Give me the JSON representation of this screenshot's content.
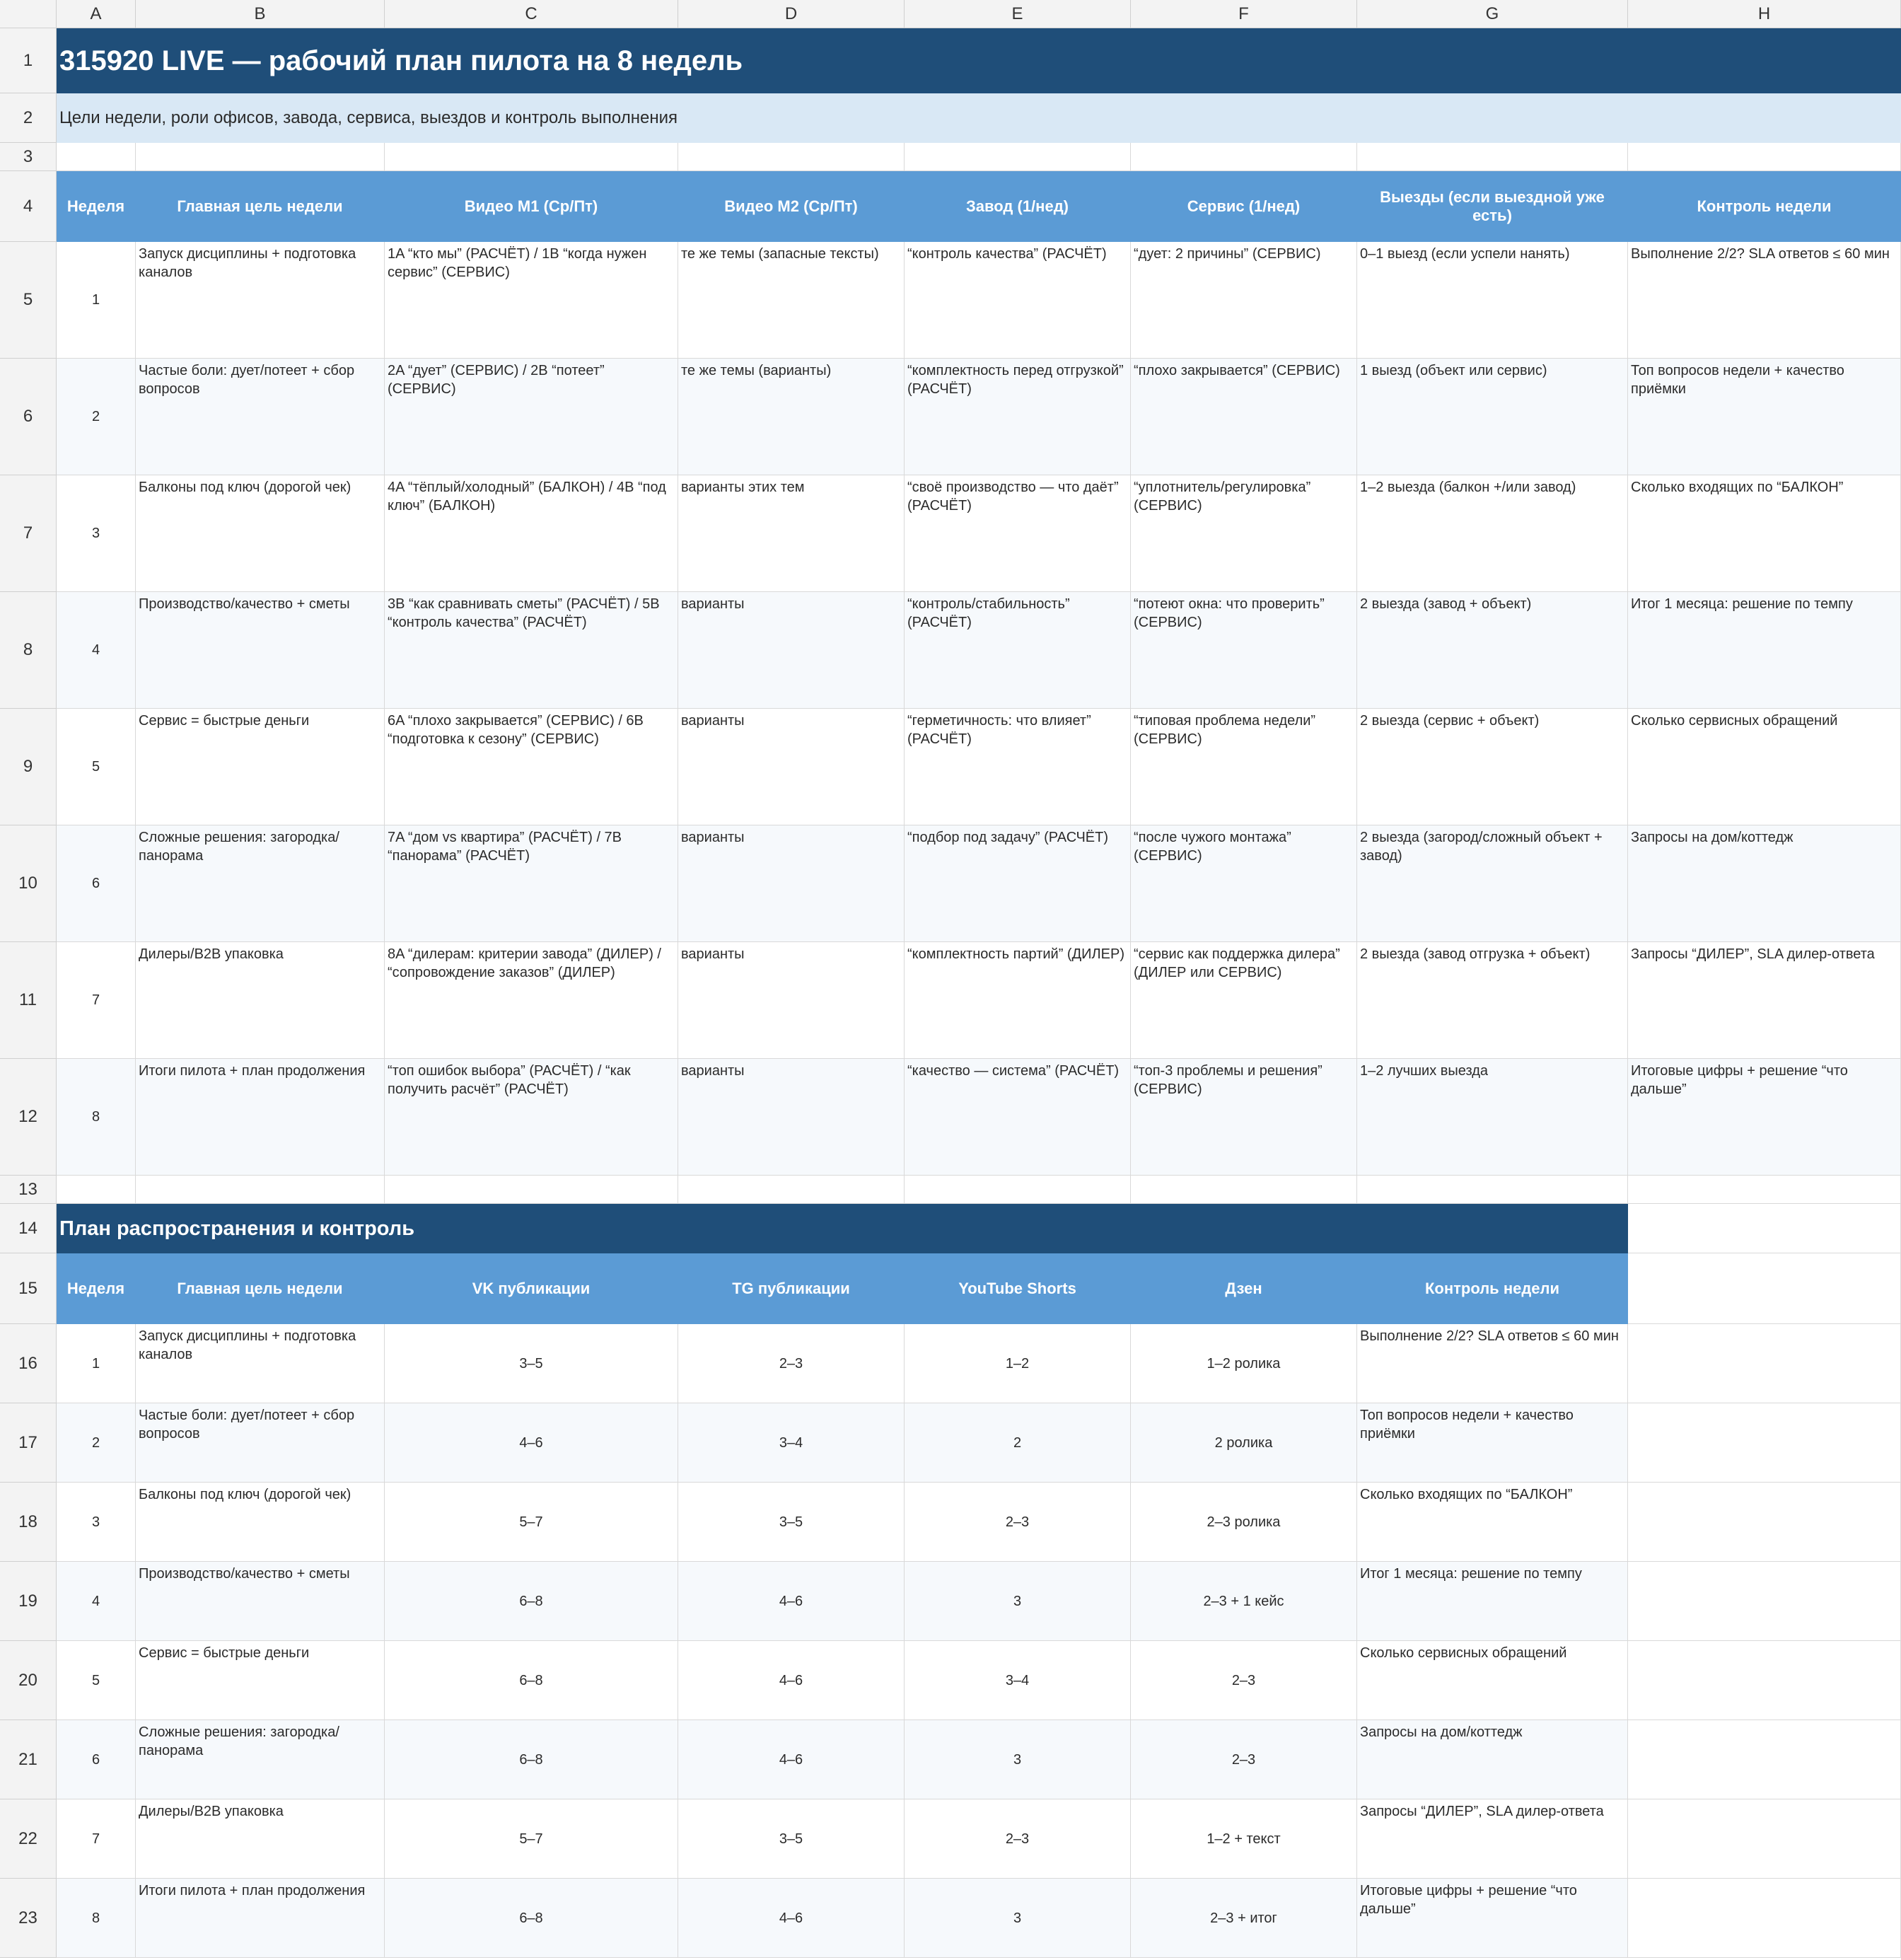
{
  "columns": [
    "A",
    "B",
    "C",
    "D",
    "E",
    "F",
    "G",
    "H"
  ],
  "rows": [
    "1",
    "2",
    "3",
    "4",
    "5",
    "6",
    "7",
    "8",
    "9",
    "10",
    "11",
    "12",
    "13",
    "14",
    "15",
    "16",
    "17",
    "18",
    "19",
    "20",
    "21",
    "22",
    "23"
  ],
  "title": "315920 LIVE — рабочий план пилота на 8 недель",
  "subtitle": "Цели недели, роли офисов, завода, сервиса, выездов и контроль выполнения",
  "plan_headers": [
    "Неделя",
    "Главная цель недели",
    "Видео М1 (Ср/Пт)",
    "Видео М2 (Ср/Пт)",
    "Завод (1/нед)",
    "Сервис (1/нед)",
    "Выезды (если выездной уже есть)",
    "Контроль недели"
  ],
  "plan_rows": [
    [
      "1",
      "Запуск дисциплины + подготовка каналов",
      "1A “кто мы” (РАСЧЁТ) / 1B “когда нужен сервис” (СЕРВИС)",
      "те же темы (запасные тексты)",
      "“контроль качества” (РАСЧЁТ)",
      "“дует: 2 причины” (СЕРВИС)",
      "0–1 выезд (если успели нанять)",
      "Выполнение 2/2? SLA ответов ≤ 60 мин"
    ],
    [
      "2",
      "Частые боли: дует/потеет + сбор вопросов",
      "2A “дует” (СЕРВИС) / 2B “потеет” (СЕРВИС)",
      "те же темы (варианты)",
      "“комплектность перед отгрузкой” (РАСЧЁТ)",
      "“плохо закрывается” (СЕРВИС)",
      "1 выезд (объект или сервис)",
      "Топ вопросов недели + качество приёмки"
    ],
    [
      "3",
      "Балконы под ключ (дорогой чек)",
      "4A “тёплый/холодный” (БАЛКОН) / 4B “под ключ” (БАЛКОН)",
      "варианты этих тем",
      "“своё производство — что даёт” (РАСЧЁТ)",
      "“уплотнитель/регулировка” (СЕРВИС)",
      "1–2 выезда (балкон +/или завод)",
      "Сколько входящих по “БАЛКОН”"
    ],
    [
      "4",
      "Производство/качество + сметы",
      "3B “как сравнивать сметы” (РАСЧЁТ) / 5B “контроль качества” (РАСЧЁТ)",
      "варианты",
      "“контроль/стабильность” (РАСЧЁТ)",
      "“потеют окна: что проверить” (СЕРВИС)",
      "2 выезда (завод + объект)",
      "Итог 1 месяца: решение по темпу"
    ],
    [
      "5",
      "Сервис = быстрые деньги",
      "6A “плохо закрывается” (СЕРВИС) / 6B “подготовка к сезону” (СЕРВИС)",
      "варианты",
      "“герметичность: что влияет” (РАСЧЁТ)",
      "“типовая проблема недели” (СЕРВИС)",
      "2 выезда (сервис + объект)",
      "Сколько сервисных обращений"
    ],
    [
      "6",
      "Сложные решения: загородка/панорама",
      "7A “дом vs квартира” (РАСЧЁТ) / 7B “панорама” (РАСЧЁТ)",
      "варианты",
      "“подбор под задачу” (РАСЧЁТ)",
      "“после чужого монтажа” (СЕРВИС)",
      "2 выезда (загород/сложный объект + завод)",
      "Запросы на дом/коттедж"
    ],
    [
      "7",
      "Дилеры/B2B упаковка",
      "8A “дилерам: критерии завода” (ДИЛЕР) / “сопровождение заказов” (ДИЛЕР)",
      "варианты",
      "“комплектность партий” (ДИЛЕР)",
      "“сервис как поддержка дилера” (ДИЛЕР или СЕРВИС)",
      "2 выезда (завод отгрузка + объект)",
      "Запросы “ДИЛЕР”, SLA дилер-ответа"
    ],
    [
      "8",
      "Итоги пилота + план продолжения",
      "“топ ошибок выбора” (РАСЧЁТ) / “как получить расчёт” (РАСЧЁТ)",
      "варианты",
      "“качество — система” (РАСЧЁТ)",
      "“топ-3 проблемы и решения” (СЕРВИС)",
      "1–2 лучших выезда",
      "Итоговые цифры + решение “что дальше”"
    ]
  ],
  "section_title": "План распространения и контроль",
  "dist_headers": [
    "Неделя",
    "Главная цель недели",
    "VK публикации",
    "TG публикации",
    "YouTube Shorts",
    "Дзен",
    "Контроль недели"
  ],
  "dist_rows": [
    [
      "1",
      "Запуск дисциплины + подготовка каналов",
      "3–5",
      "2–3",
      "1–2",
      "1–2 ролика",
      "Выполнение 2/2? SLA ответов ≤ 60 мин"
    ],
    [
      "2",
      "Частые боли: дует/потеет + сбор вопросов",
      "4–6",
      "3–4",
      "2",
      "2 ролика",
      "Топ вопросов недели + качество приёмки"
    ],
    [
      "3",
      "Балконы под ключ (дорогой чек)",
      "5–7",
      "3–5",
      "2–3",
      "2–3 ролика",
      "Сколько входящих по “БАЛКОН”"
    ],
    [
      "4",
      "Производство/качество + сметы",
      "6–8",
      "4–6",
      "3",
      "2–3 + 1 кейс",
      "Итог 1 месяца: решение по темпу"
    ],
    [
      "5",
      "Сервис = быстрые деньги",
      "6–8",
      "4–6",
      "3–4",
      "2–3",
      "Сколько сервисных обращений"
    ],
    [
      "6",
      "Сложные решения: загородка/панорама",
      "6–8",
      "4–6",
      "3",
      "2–3",
      "Запросы на дом/коттедж"
    ],
    [
      "7",
      "Дилеры/B2B упаковка",
      "5–7",
      "3–5",
      "2–3",
      "1–2 + текст",
      "Запросы “ДИЛЕР”, SLA дилер-ответа"
    ],
    [
      "8",
      "Итоги пилота + план продолжения",
      "6–8",
      "4–6",
      "3",
      "2–3 + итог",
      "Итоговые цифры + решение “что дальше”"
    ]
  ],
  "colors": {
    "title_bg": "#1f4e79",
    "subtitle_bg": "#d9e8f5",
    "header_bg": "#5b9bd5",
    "alt_row_bg": "#f6f9fc",
    "gridline": "#d9d9d9"
  }
}
